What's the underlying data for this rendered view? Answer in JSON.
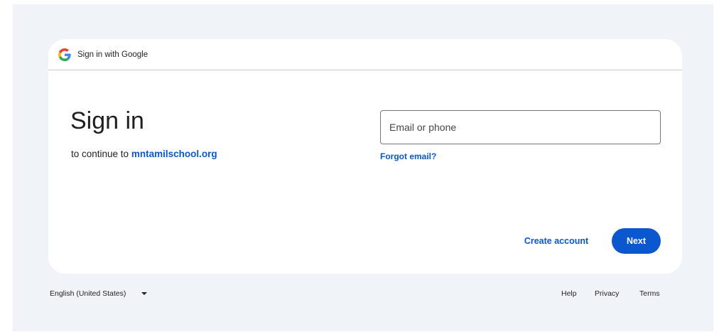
{
  "header": {
    "title": "Sign in with Google",
    "logo_icon": "google-g-icon"
  },
  "main": {
    "title": "Sign in",
    "subtitle_prefix": "to continue to",
    "site_name": "mntamilschool.org"
  },
  "form": {
    "email_placeholder": "Email or phone",
    "email_value": "",
    "forgot_email_label": "Forgot email?"
  },
  "actions": {
    "create_account_label": "Create account",
    "next_label": "Next"
  },
  "footer": {
    "language": "English (United States)",
    "language_dropdown_icon": "caret-down-icon",
    "links": [
      "Help",
      "Privacy",
      "Terms"
    ]
  },
  "colors": {
    "accent": "#0b57d0",
    "background": "#f0f4f9",
    "card": "#ffffff",
    "text": "#1f1f1f"
  }
}
